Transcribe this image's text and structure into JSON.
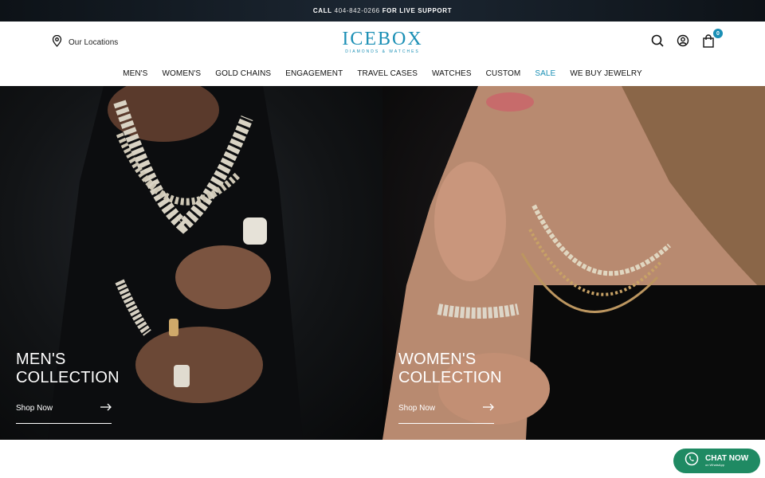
{
  "topbar": {
    "prefix": "CALL",
    "phone": "404-842-0266",
    "suffix": "FOR LIVE SUPPORT"
  },
  "header": {
    "locations_label": "Our Locations",
    "logo": {
      "brand": "ICEBOX",
      "tagline": "DIAMONDS & WATCHES"
    },
    "cart_count": "0",
    "accent_color": "#1a8fb5"
  },
  "nav": {
    "items": [
      "MEN'S",
      "WOMEN'S",
      "GOLD CHAINS",
      "ENGAGEMENT",
      "TRAVEL CASES",
      "WATCHES",
      "CUSTOM",
      "SALE",
      "WE BUY JEWELRY"
    ]
  },
  "hero": {
    "men": {
      "title_line1": "MEN'S",
      "title_line2": "COLLECTION",
      "cta": "Shop Now"
    },
    "women": {
      "title_line1": "WOMEN'S",
      "title_line2": "COLLECTION",
      "cta": "Shop Now"
    }
  },
  "chat": {
    "label": "CHAT NOW",
    "sublabel": "on WhatsApp",
    "color": "#1f8a63"
  },
  "icons": [
    "location-pin-icon",
    "search-icon",
    "account-icon",
    "shopping-bag-icon",
    "arrow-right-icon",
    "whatsapp-icon"
  ]
}
